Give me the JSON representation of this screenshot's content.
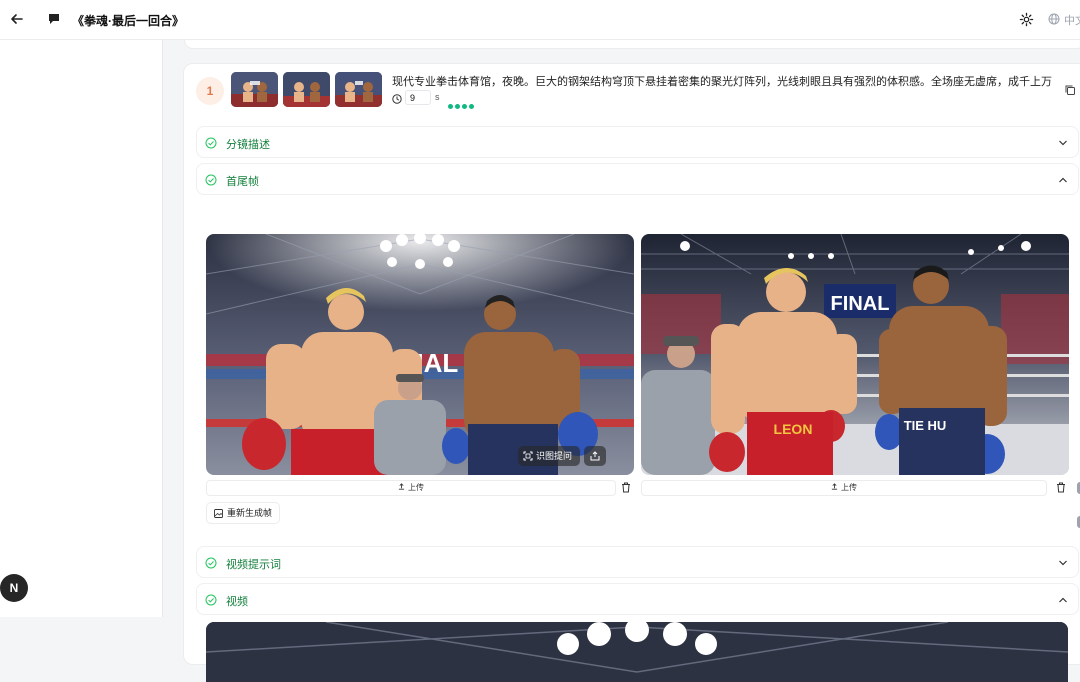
{
  "header": {
    "title": "《拳魂·最后一回合》",
    "language_label": "中文",
    "icons": {
      "back": "arrow-left-icon",
      "chat": "chat-bubble-icon",
      "settings": "gear-icon",
      "language": "globe-icon"
    }
  },
  "user": {
    "avatar_letter": "N"
  },
  "scene": {
    "number": "1",
    "description": "现代专业拳击体育馆，夜晚。巨大的钢架结构穹顶下悬挂着密集的聚光灯阵列，光线刺眼且具有强烈的体积感。全场座无虚席，成千上万的观...",
    "duration_value": "9",
    "duration_unit": "s",
    "status_dots": 4,
    "thumbnail_count": 3
  },
  "sections": {
    "storyboard": {
      "label": "分镜描述",
      "expanded": false
    },
    "first_last_frames": {
      "label": "首尾帧",
      "expanded": true
    },
    "video_prompt": {
      "label": "视频提示词",
      "expanded": false
    },
    "video": {
      "label": "视频",
      "expanded": true
    }
  },
  "frames": {
    "first": {
      "banner_text": "FINAL",
      "upload_label": "上传"
    },
    "last": {
      "banner_text": "FINAL",
      "upload_label": "上传",
      "shorts_left": "LEON",
      "shorts_right": "TIE HU"
    },
    "overlay_button_label": "识图提问",
    "regenerate_label": "重新生成帧"
  },
  "colors": {
    "accent_green": "#15803d",
    "scene_badge_bg": "#fdeee6",
    "scene_badge_text": "#e07a4f",
    "status_dot": "#10b981"
  }
}
